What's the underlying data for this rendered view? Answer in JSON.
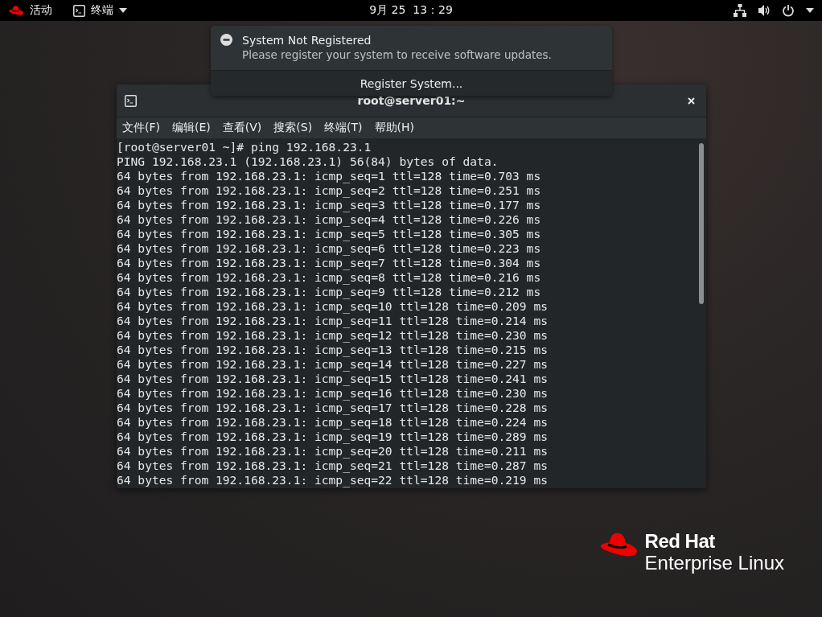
{
  "top_bar": {
    "activities": "活动",
    "app_menu": "终端",
    "clock": "9月 25  13：29"
  },
  "notification": {
    "title": "System Not Registered",
    "body": "Please register your system to receive software updates.",
    "action": "Register System..."
  },
  "terminal": {
    "title": "root@server01:~",
    "menu": [
      "文件(F)",
      "编辑(E)",
      "查看(V)",
      "搜索(S)",
      "终端(T)",
      "帮助(H)"
    ],
    "lines": [
      "[root@server01 ~]# ping 192.168.23.1",
      "PING 192.168.23.1 (192.168.23.1) 56(84) bytes of data.",
      "64 bytes from 192.168.23.1: icmp_seq=1 ttl=128 time=0.703 ms",
      "64 bytes from 192.168.23.1: icmp_seq=2 ttl=128 time=0.251 ms",
      "64 bytes from 192.168.23.1: icmp_seq=3 ttl=128 time=0.177 ms",
      "64 bytes from 192.168.23.1: icmp_seq=4 ttl=128 time=0.226 ms",
      "64 bytes from 192.168.23.1: icmp_seq=5 ttl=128 time=0.305 ms",
      "64 bytes from 192.168.23.1: icmp_seq=6 ttl=128 time=0.223 ms",
      "64 bytes from 192.168.23.1: icmp_seq=7 ttl=128 time=0.304 ms",
      "64 bytes from 192.168.23.1: icmp_seq=8 ttl=128 time=0.216 ms",
      "64 bytes from 192.168.23.1: icmp_seq=9 ttl=128 time=0.212 ms",
      "64 bytes from 192.168.23.1: icmp_seq=10 ttl=128 time=0.209 ms",
      "64 bytes from 192.168.23.1: icmp_seq=11 ttl=128 time=0.214 ms",
      "64 bytes from 192.168.23.1: icmp_seq=12 ttl=128 time=0.230 ms",
      "64 bytes from 192.168.23.1: icmp_seq=13 ttl=128 time=0.215 ms",
      "64 bytes from 192.168.23.1: icmp_seq=14 ttl=128 time=0.227 ms",
      "64 bytes from 192.168.23.1: icmp_seq=15 ttl=128 time=0.241 ms",
      "64 bytes from 192.168.23.1: icmp_seq=16 ttl=128 time=0.230 ms",
      "64 bytes from 192.168.23.1: icmp_seq=17 ttl=128 time=0.228 ms",
      "64 bytes from 192.168.23.1: icmp_seq=18 ttl=128 time=0.224 ms",
      "64 bytes from 192.168.23.1: icmp_seq=19 ttl=128 time=0.289 ms",
      "64 bytes from 192.168.23.1: icmp_seq=20 ttl=128 time=0.211 ms",
      "64 bytes from 192.168.23.1: icmp_seq=21 ttl=128 time=0.287 ms",
      "64 bytes from 192.168.23.1: icmp_seq=22 ttl=128 time=0.219 ms"
    ]
  },
  "logo": {
    "brand": "Red Hat",
    "product": "Enterprise Linux"
  }
}
